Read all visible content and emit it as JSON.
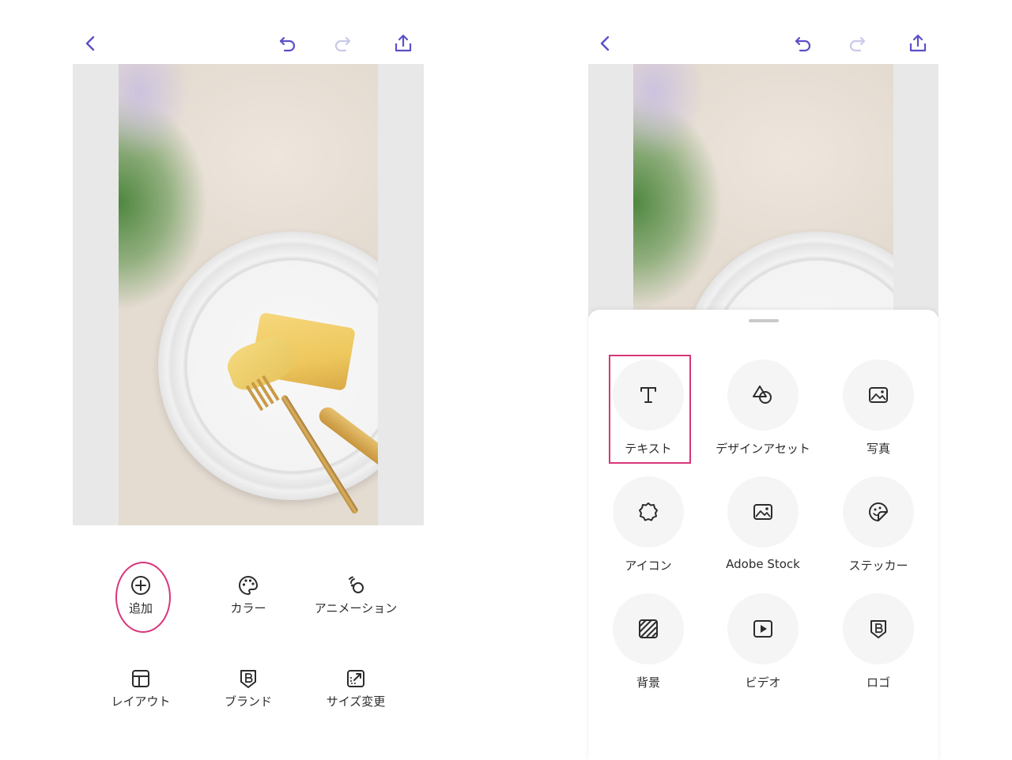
{
  "colors": {
    "accent": "#5b4fc9",
    "highlight": "#d9357a",
    "disabled": "#c9c9e8",
    "icon": "#2c2c2c"
  },
  "left_screen": {
    "topbar": {
      "icons": [
        "back-icon",
        "undo-icon",
        "redo-icon",
        "share-icon"
      ]
    },
    "toolbar": [
      {
        "label": "追加",
        "icon": "plus-circle-icon",
        "highlighted": true
      },
      {
        "label": "カラー",
        "icon": "palette-icon"
      },
      {
        "label": "アニメーション",
        "icon": "animation-icon"
      },
      {
        "label": "レイアウト",
        "icon": "layout-icon"
      },
      {
        "label": "ブランド",
        "icon": "brand-icon"
      },
      {
        "label": "サイズ変更",
        "icon": "resize-icon"
      }
    ]
  },
  "right_screen": {
    "topbar": {
      "icons": [
        "back-icon",
        "undo-icon",
        "redo-icon",
        "share-icon"
      ]
    },
    "add_menu": [
      {
        "label": "テキスト",
        "icon": "text-icon",
        "highlighted": true
      },
      {
        "label": "デザインアセット",
        "icon": "design-assets-icon"
      },
      {
        "label": "写真",
        "icon": "photo-icon"
      },
      {
        "label": "アイコン",
        "icon": "icon-badge-icon"
      },
      {
        "label": "Adobe Stock",
        "icon": "adobe-stock-icon"
      },
      {
        "label": "ステッカー",
        "icon": "sticker-icon"
      },
      {
        "label": "背景",
        "icon": "background-icon"
      },
      {
        "label": "ビデオ",
        "icon": "video-icon"
      },
      {
        "label": "ロゴ",
        "icon": "logo-icon"
      }
    ]
  }
}
